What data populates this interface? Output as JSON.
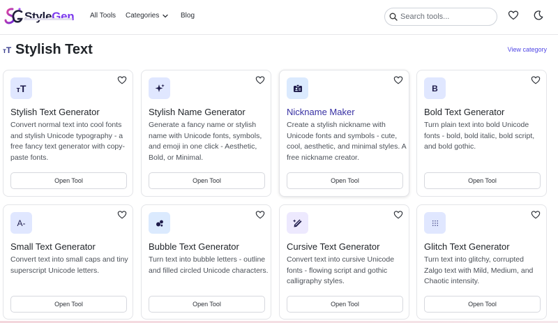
{
  "brand": {
    "name_a": "Style",
    "name_b": "Gen"
  },
  "nav": {
    "all_tools": "All Tools",
    "categories": "Categories",
    "blog": "Blog"
  },
  "search": {
    "placeholder": "Search tools..."
  },
  "page": {
    "title": "Stylish Text",
    "view_category": "View category"
  },
  "cards": [
    {
      "title": "Stylish Text Generator",
      "desc": "Convert normal text into cool fonts and stylish Unicode typography - a free fancy text generator with copy-paste fonts.",
      "button": "Open Tool",
      "icon": "text-size-icon",
      "icon_glyph": "TT"
    },
    {
      "title": "Stylish Name Generator",
      "desc": "Generate a fancy name or stylish name with Unicode fonts, symbols, and emoji in one click - Aesthetic, Bold, or Minimal.",
      "button": "Open Tool",
      "icon": "sparkles-icon",
      "icon_glyph": "✦"
    },
    {
      "title": "Nickname Maker",
      "desc": "Create a stylish nickname with Unicode fonts and symbols - cute, cool, aesthetic, and minimal styles. A free nickname creator.",
      "button": "Open Tool",
      "icon": "id-badge-icon",
      "icon_glyph": ""
    },
    {
      "title": "Bold Text Generator",
      "desc": "Turn plain text into bold Unicode fonts - bold, bold italic, bold script, and bold gothic.",
      "button": "Open Tool",
      "icon": "bold-icon",
      "icon_glyph": "B"
    },
    {
      "title": "Small Text Generator",
      "desc": "Convert text into small caps and tiny superscript Unicode letters.",
      "button": "Open Tool",
      "icon": "small-text-icon",
      "icon_glyph": "A-"
    },
    {
      "title": "Bubble Text Generator",
      "desc": "Turn text into bubble letters - outline and filled circled Unicode characters.",
      "button": "Open Tool",
      "icon": "bubbles-icon",
      "icon_glyph": ""
    },
    {
      "title": "Cursive Text Generator",
      "desc": "Convert text into cursive Unicode fonts - flowing script and gothic calligraphy styles.",
      "button": "Open Tool",
      "icon": "pen-icon",
      "icon_glyph": ""
    },
    {
      "title": "Glitch Text Generator",
      "desc": "Turn text into glitchy, corrupted Zalgo text with Mild, Medium, and Chaotic intensity.",
      "button": "Open Tool",
      "icon": "glitch-grid-icon",
      "icon_glyph": ""
    }
  ],
  "colors": {
    "accent": "#4f46e5",
    "brand_purple": "#7c3aed",
    "icon_bg_blue": "#e0e7ff",
    "icon_bg_purple": "#ede9fe",
    "icon_bg_sky": "#dbeafe"
  }
}
